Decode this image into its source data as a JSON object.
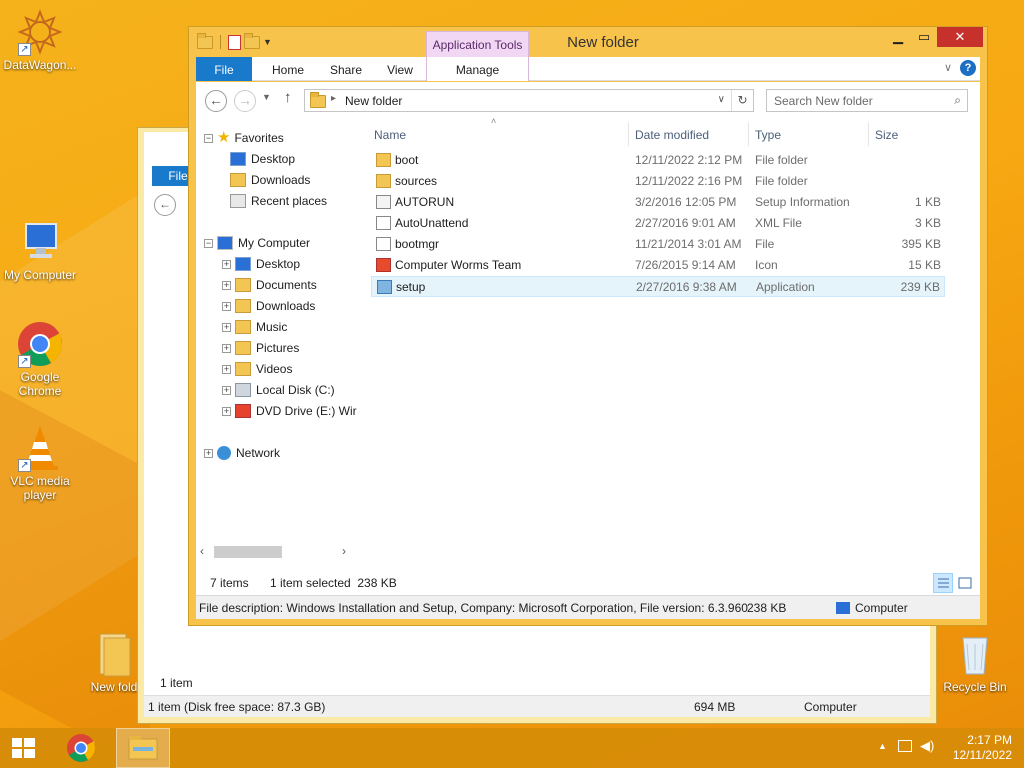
{
  "desktop": {
    "icons": [
      {
        "label": "DataWagon..."
      },
      {
        "label": "My Computer"
      },
      {
        "label": "Google Chrome"
      },
      {
        "label": "VLC media player"
      },
      {
        "label": "New fold"
      },
      {
        "label": "Recycle Bin"
      }
    ]
  },
  "back_window": {
    "file_tab": "File",
    "status_items": "1 item",
    "status_detail": "1 item (Disk free space: 87.3 GB)",
    "status_size": "694 MB",
    "status_location": "Computer"
  },
  "window": {
    "title": "New folder",
    "context_tab": "Application Tools",
    "ribbon_tabs": [
      "File",
      "Home",
      "Share",
      "View",
      "Manage"
    ],
    "address_path": "New folder",
    "search_placeholder": "Search New folder",
    "nav": {
      "favorites": "Favorites",
      "favorites_items": [
        "Desktop",
        "Downloads",
        "Recent places"
      ],
      "computer": "My Computer",
      "computer_items": [
        "Desktop",
        "Documents",
        "Downloads",
        "Music",
        "Pictures",
        "Videos",
        "Local Disk (C:)",
        "DVD Drive (E:) Wir"
      ],
      "network": "Network"
    },
    "columns": {
      "name": "Name",
      "date": "Date modified",
      "type": "Type",
      "size": "Size"
    },
    "files": [
      {
        "name": "boot",
        "date": "12/11/2022 2:12 PM",
        "type": "File folder",
        "size": "",
        "icon": "folder-icon"
      },
      {
        "name": "sources",
        "date": "12/11/2022 2:16 PM",
        "type": "File folder",
        "size": "",
        "icon": "folder-icon"
      },
      {
        "name": "AUTORUN",
        "date": "3/2/2016 12:05 PM",
        "type": "Setup Information",
        "size": "1 KB",
        "icon": "setup-info-icon"
      },
      {
        "name": "AutoUnattend",
        "date": "2/27/2016 9:01 AM",
        "type": "XML File",
        "size": "3 KB",
        "icon": "xml-file-icon"
      },
      {
        "name": "bootmgr",
        "date": "11/21/2014 3:01 AM",
        "type": "File",
        "size": "395 KB",
        "icon": "file-icon"
      },
      {
        "name": "Computer Worms Team",
        "date": "7/26/2015 9:14 AM",
        "type": "Icon",
        "size": "15 KB",
        "icon": "icon-file-icon"
      },
      {
        "name": "setup",
        "date": "2/27/2016 9:38 AM",
        "type": "Application",
        "size": "239 KB",
        "icon": "setup-app-icon",
        "selected": true
      }
    ],
    "status": {
      "items": "7 items",
      "selected": "1 item selected  238 KB"
    },
    "details": {
      "description": "File description: Windows Installation and Setup, Company: Microsoft Corporation, File version: 6.3.960",
      "size": "238 KB",
      "location": "Computer"
    }
  },
  "taskbar": {
    "time": "2:17 PM",
    "date": "12/11/2022"
  },
  "colors": {
    "desktop": "#f7a812",
    "window_frame": "#f7c34a",
    "file_tab": "#1979ca",
    "context_tab": "#f1d7f3",
    "selection": "#e5f3fb",
    "close_button": "#c7312c"
  }
}
